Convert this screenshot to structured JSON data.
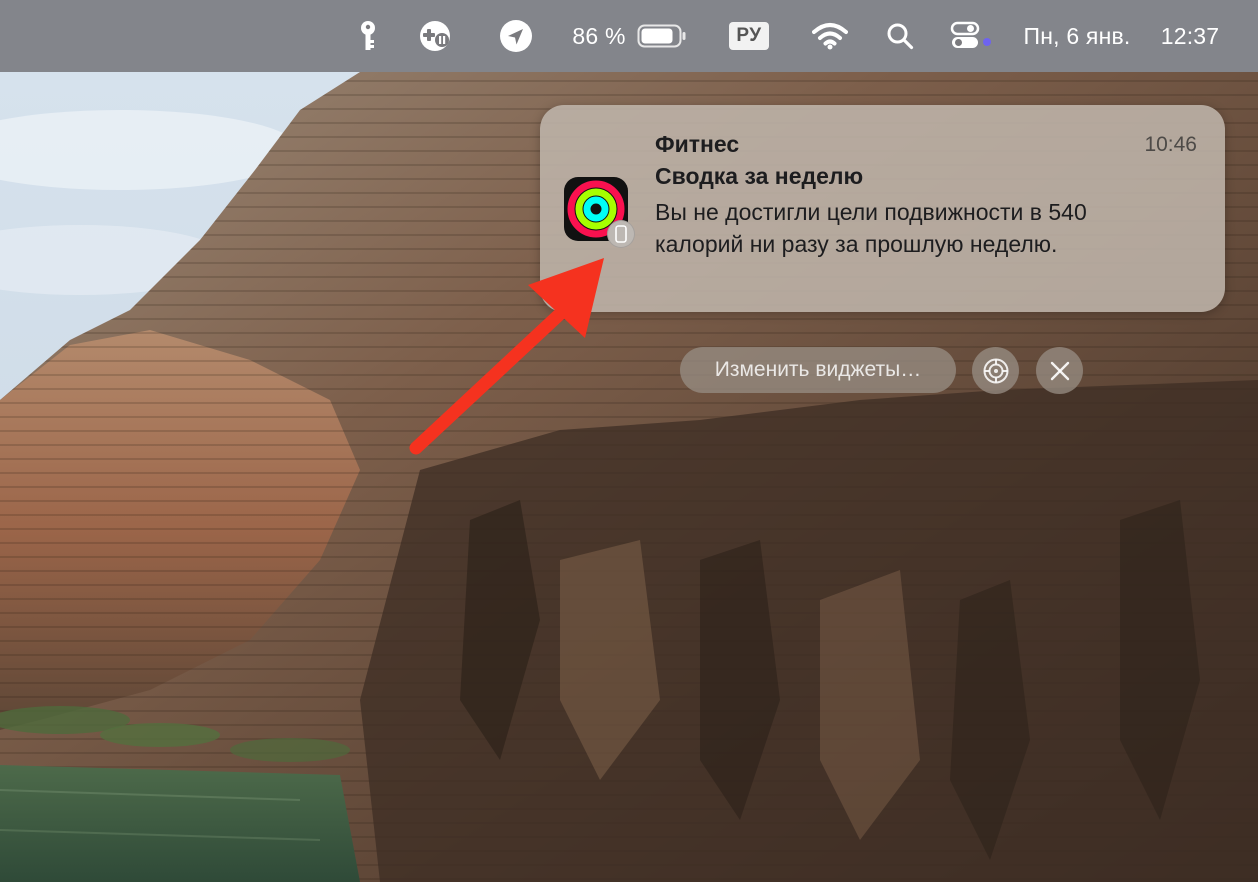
{
  "menubar": {
    "battery_percent": "86 %",
    "battery_level": 0.86,
    "input_source": "РУ",
    "date": "Пн, 6 янв.",
    "time": "12:37",
    "icons": [
      "key-icon",
      "gamepad-icon",
      "location-arrow-icon",
      "battery-icon",
      "wifi-icon",
      "search-icon",
      "control-center-icon"
    ]
  },
  "notification": {
    "app_name": "Фитнес",
    "time": "10:46",
    "title": "Сводка за неделю",
    "body": "Вы не достигли цели подвижности в 540 калорий ни разу за прошлую неделю.",
    "icon": "activity-rings-icon",
    "source_icon": "iphone-icon"
  },
  "widgets": {
    "edit_label": "Изменить виджеты…",
    "settings_icon": "gear-icon",
    "close_icon": "close-icon"
  },
  "colors": {
    "annotation_arrow": "#f5321f",
    "ring_move": "#fa114f",
    "ring_exercise": "#a6ff00",
    "ring_stand": "#00fff6"
  }
}
